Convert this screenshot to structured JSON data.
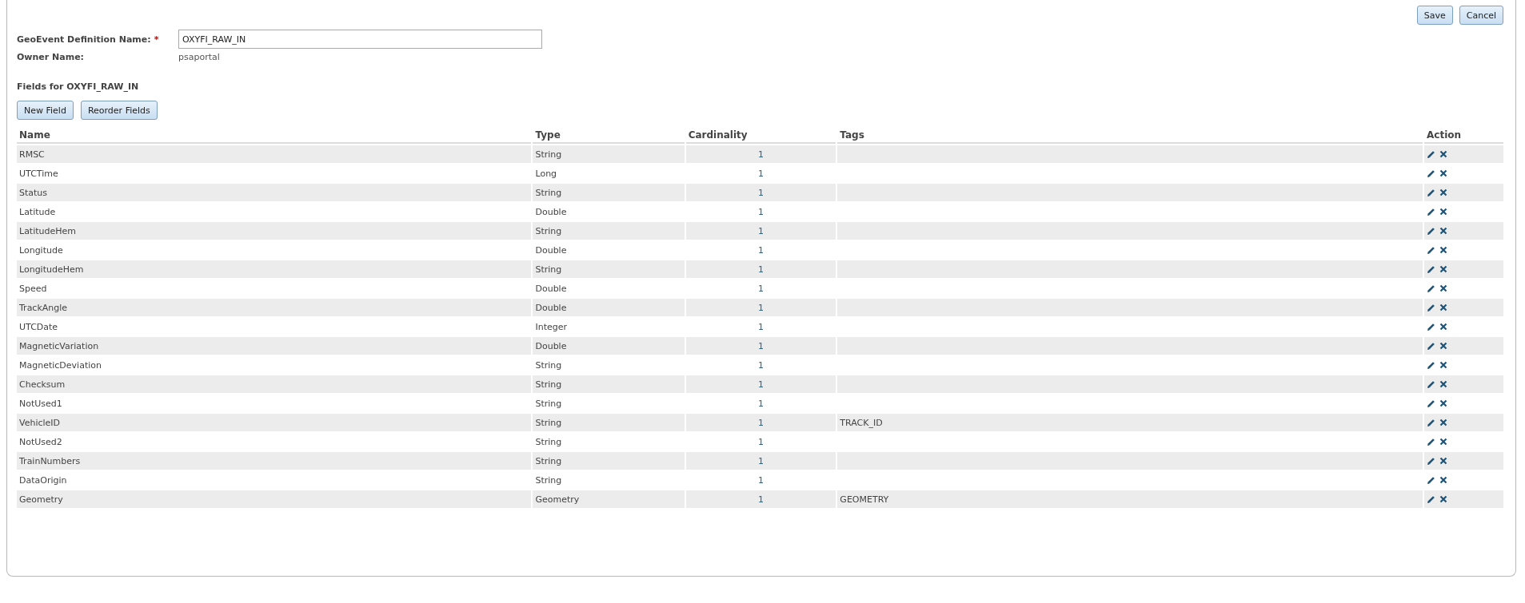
{
  "header_buttons": [
    "Save",
    "Cancel"
  ],
  "definition_name": {
    "label": "GeoEvent Definition Name:",
    "required_mark": "*",
    "value": "OXYFI_RAW_IN"
  },
  "owner": {
    "label": "Owner Name:",
    "value": "psaportal"
  },
  "fields_heading": "Fields for OXYFI_RAW_IN",
  "field_buttons": [
    "New Field",
    "Reorder Fields"
  ],
  "table": {
    "columns": [
      "Name",
      "Type",
      "Cardinality",
      "Tags",
      "Action"
    ],
    "rows": [
      {
        "name": "RMSC",
        "type": "String",
        "cardinality": "1",
        "tags": ""
      },
      {
        "name": "UTCTime",
        "type": "Long",
        "cardinality": "1",
        "tags": ""
      },
      {
        "name": "Status",
        "type": "String",
        "cardinality": "1",
        "tags": ""
      },
      {
        "name": "Latitude",
        "type": "Double",
        "cardinality": "1",
        "tags": ""
      },
      {
        "name": "LatitudeHem",
        "type": "String",
        "cardinality": "1",
        "tags": ""
      },
      {
        "name": "Longitude",
        "type": "Double",
        "cardinality": "1",
        "tags": ""
      },
      {
        "name": "LongitudeHem",
        "type": "String",
        "cardinality": "1",
        "tags": ""
      },
      {
        "name": "Speed",
        "type": "Double",
        "cardinality": "1",
        "tags": ""
      },
      {
        "name": "TrackAngle",
        "type": "Double",
        "cardinality": "1",
        "tags": ""
      },
      {
        "name": "UTCDate",
        "type": "Integer",
        "cardinality": "1",
        "tags": ""
      },
      {
        "name": "MagneticVariation",
        "type": "Double",
        "cardinality": "1",
        "tags": ""
      },
      {
        "name": "MagneticDeviation",
        "type": "String",
        "cardinality": "1",
        "tags": ""
      },
      {
        "name": "Checksum",
        "type": "String",
        "cardinality": "1",
        "tags": ""
      },
      {
        "name": "NotUsed1",
        "type": "String",
        "cardinality": "1",
        "tags": ""
      },
      {
        "name": "VehicleID",
        "type": "String",
        "cardinality": "1",
        "tags": "TRACK_ID"
      },
      {
        "name": "NotUsed2",
        "type": "String",
        "cardinality": "1",
        "tags": ""
      },
      {
        "name": "TrainNumbers",
        "type": "String",
        "cardinality": "1",
        "tags": ""
      },
      {
        "name": "DataOrigin",
        "type": "String",
        "cardinality": "1",
        "tags": ""
      },
      {
        "name": "Geometry",
        "type": "Geometry",
        "cardinality": "1",
        "tags": "GEOMETRY"
      }
    ]
  }
}
